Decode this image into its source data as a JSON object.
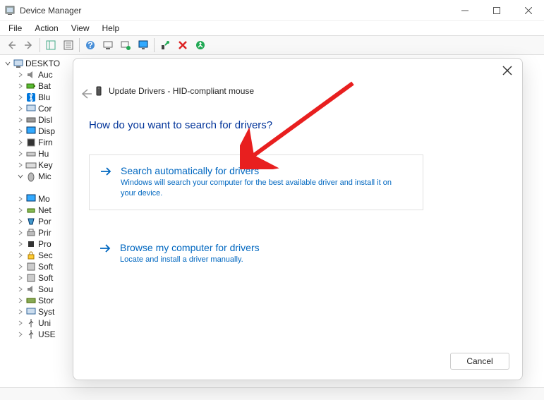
{
  "window": {
    "title": "Device Manager"
  },
  "menu": {
    "file": "File",
    "action": "Action",
    "view": "View",
    "help": "Help"
  },
  "tree": {
    "root": "DESKTO",
    "nodes": {
      "audio": "Auc",
      "batteries": "Bat",
      "bluetooth": "Blu",
      "computer": "Cor",
      "disk": "Disl",
      "display": "Disp",
      "firmware": "Firn",
      "hid": "Hu",
      "keyboards": "Key",
      "mice": "Mic",
      "monitors": "Mo",
      "network": "Net",
      "ports": "Por",
      "print": "Prir",
      "processors": "Pro",
      "security": "Sec",
      "software": "Soft",
      "softcomp": "Soft",
      "sound": "Sou",
      "storage": "Stor",
      "system": "Syst",
      "universal": "Uni",
      "usb": "USE"
    }
  },
  "dialog": {
    "title": "Update Drivers - HID-compliant mouse",
    "question": "How do you want to search for drivers?",
    "option1": {
      "title": "Search automatically for drivers",
      "desc": "Windows will search your computer for the best available driver and install it on your device."
    },
    "option2": {
      "title": "Browse my computer for drivers",
      "desc": "Locate and install a driver manually."
    },
    "cancel": "Cancel"
  }
}
